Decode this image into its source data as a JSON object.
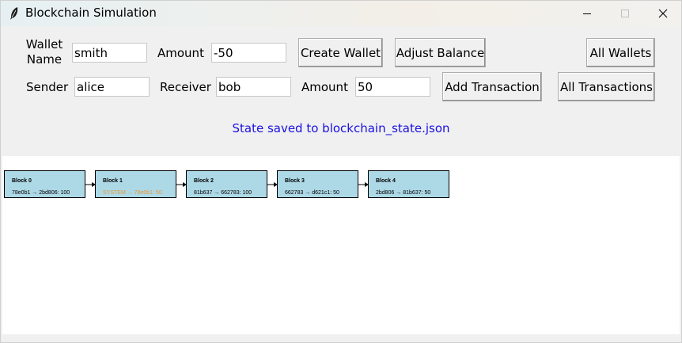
{
  "window": {
    "title": "Blockchain Simulation"
  },
  "wallet_row": {
    "wallet_name_label": "Wallet Name",
    "wallet_name_value": "smith",
    "amount_label": "Amount",
    "amount_value": "-50",
    "create_wallet_label": "Create Wallet",
    "adjust_balance_label": "Adjust Balance",
    "all_wallets_label": "All Wallets"
  },
  "transaction_row": {
    "sender_label": "Sender",
    "sender_value": "alice",
    "receiver_label": "Receiver",
    "receiver_value": "bob",
    "amount_label": "Amount",
    "amount_value": "50",
    "add_transaction_label": "Add Transaction",
    "all_transactions_label": "All Transactions"
  },
  "status": {
    "message": "State saved to blockchain_state.json",
    "color": "#1a10e0"
  },
  "blocks": [
    {
      "title": "Block 0",
      "tx": "78e0b1 → 2bd806: 100",
      "tx_color": "#000000"
    },
    {
      "title": "Block 1",
      "tx": "SYSTEM → 78e0b1: 50",
      "tx_color": "#e59a3a"
    },
    {
      "title": "Block 2",
      "tx": "81b637 → 662783: 100",
      "tx_color": "#000000"
    },
    {
      "title": "Block 3",
      "tx": "662783 → d621c1: 50",
      "tx_color": "#000000"
    },
    {
      "title": "Block 4",
      "tx": "2bd806 → 81b637: 50",
      "tx_color": "#000000"
    }
  ],
  "colors": {
    "block_fill": "#add8e6",
    "window_bg": "#f0f0f0",
    "canvas_bg": "#ffffff"
  }
}
